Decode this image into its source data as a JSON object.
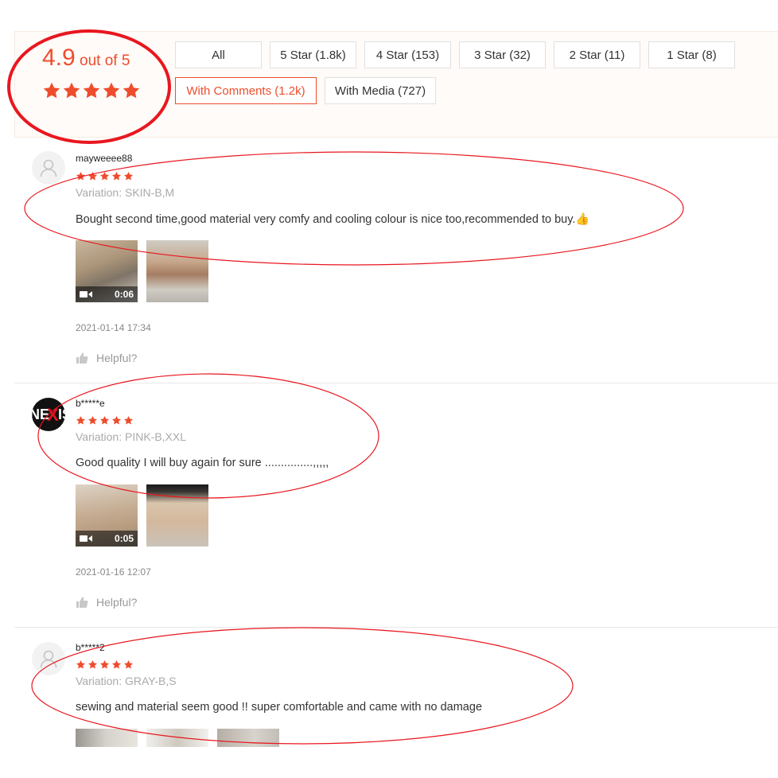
{
  "rating": {
    "score": "4.9",
    "out_of": " out of 5",
    "accent_color": "#ee4d2d",
    "stars": 5
  },
  "filters": [
    {
      "label": "All",
      "active": false
    },
    {
      "label": "5 Star (1.8k)",
      "active": false
    },
    {
      "label": "4 Star (153)",
      "active": false
    },
    {
      "label": "3 Star (32)",
      "active": false
    },
    {
      "label": "2 Star (11)",
      "active": false
    },
    {
      "label": "1 Star (8)",
      "active": false
    },
    {
      "label": "With Comments (1.2k)",
      "active": true
    },
    {
      "label": "With Media (727)",
      "active": false
    }
  ],
  "reviews": [
    {
      "username": "mayweeee88",
      "avatar": "default-user-icon",
      "stars": 5,
      "variation": "Variation: SKIN-B,M",
      "comment": "Bought second time,good material very comfy and cooling colour  is nice too,recommended to buy.👍",
      "video_duration": "0:06",
      "date": "2021-01-14 17:34",
      "helpful": "Helpful?"
    },
    {
      "username": "b*****e",
      "avatar": "nexis-logo",
      "avatar_text": "NEXIS",
      "stars": 5,
      "variation": "Variation: PINK-B,XXL",
      "comment": "Good quality I will buy again for sure ...............,,,,,",
      "video_duration": "0:05",
      "date": "2021-01-16 12:07",
      "helpful": "Helpful?"
    },
    {
      "username": "b*****2",
      "avatar": "default-user-icon",
      "stars": 5,
      "variation": "Variation: GRAY-B,S",
      "comment": "sewing and material seem good !! super comfortable and came with no damage"
    }
  ],
  "annotation_color": "#e8171f"
}
